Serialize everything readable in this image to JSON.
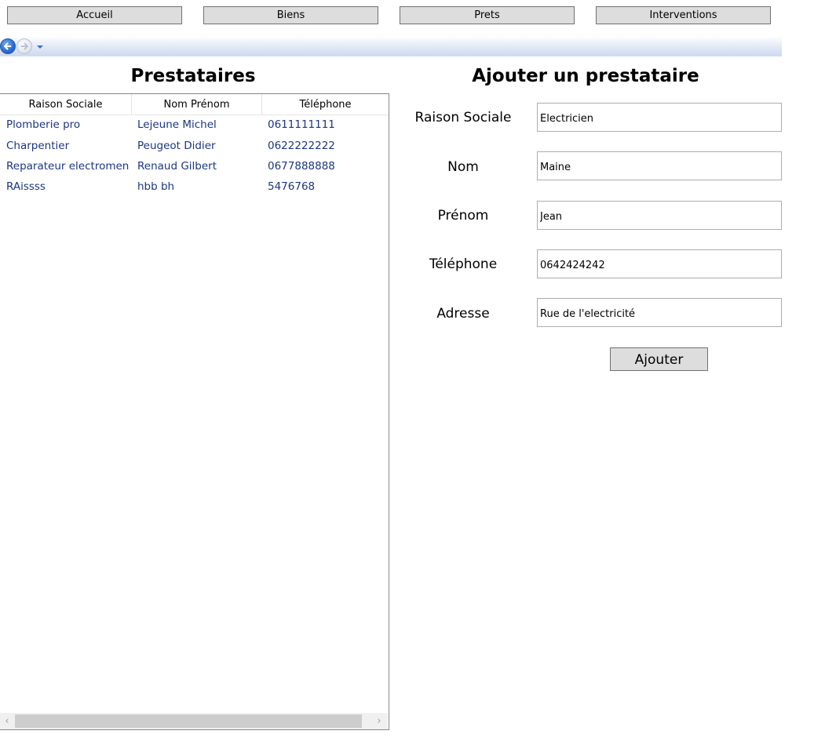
{
  "nav": {
    "buttons": [
      "Accueil",
      "Biens",
      "Prets",
      "Interventions"
    ]
  },
  "list": {
    "title": "Prestataires",
    "columns": [
      "Raison Sociale",
      "Nom Prénom",
      "Téléphone"
    ],
    "rows": [
      [
        "Plomberie pro",
        "Lejeune Michel",
        "0611111111"
      ],
      [
        "Charpentier",
        "Peugeot Didier",
        "0622222222"
      ],
      [
        "Reparateur electromen",
        "Renaud Gilbert",
        "0677888888"
      ],
      [
        "RAissss",
        "hbb bh",
        "5476768"
      ]
    ]
  },
  "form": {
    "title": "Ajouter un prestataire",
    "fields": [
      {
        "label": "Raison Sociale",
        "value": "Electricien"
      },
      {
        "label": "Nom",
        "value": "Maine"
      },
      {
        "label": "Prénom",
        "value": "Jean"
      },
      {
        "label": "Téléphone",
        "value": "0642424242"
      },
      {
        "label": "Adresse",
        "value": "Rue de l'electricité"
      }
    ],
    "submit_label": "Ajouter"
  },
  "icons": {
    "back": "back-arrow-icon",
    "forward": "forward-arrow-icon",
    "history": "chevron-down-icon"
  },
  "colors": {
    "cell_text": "#1c3680",
    "button_bg": "#dddddd"
  }
}
